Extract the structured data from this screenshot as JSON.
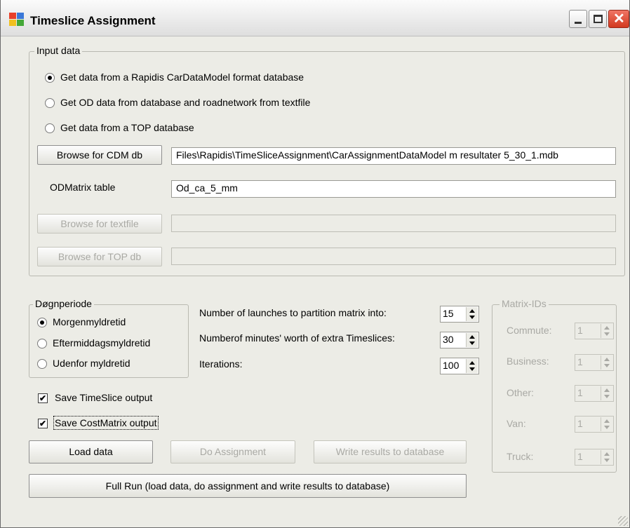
{
  "window": {
    "title": "Timeslice Assignment",
    "icon": "app-windows-icon",
    "controls": {
      "minimize": "minimize-icon",
      "maximize": "maximize-icon",
      "close": "close-icon"
    }
  },
  "input_data": {
    "group_label": "Input data",
    "radios": [
      {
        "label": "Get data from a Rapidis CarDataModel format database",
        "selected": true
      },
      {
        "label": "Get OD data from database and roadnetwork from textfile",
        "selected": false
      },
      {
        "label": "Get data from a TOP database",
        "selected": false
      }
    ],
    "browse_cdm_label": "Browse for CDM db",
    "cdm_path": "Files\\Rapidis\\TimeSliceAssignment\\CarAssignmentDataModel m resultater 5_30_1.mdb",
    "odmatrix_label": "ODMatrix table",
    "odmatrix_value": "Od_ca_5_mm",
    "browse_textfile_label": "Browse for textfile",
    "textfile_value": "",
    "browse_top_label": "Browse for TOP db",
    "top_value": ""
  },
  "dognperiode": {
    "group_label": "Døgnperiode",
    "radios": [
      {
        "label": "Morgenmyldretid",
        "selected": true
      },
      {
        "label": "Eftermiddagsmyldretid",
        "selected": false
      },
      {
        "label": "Udenfor myldretid",
        "selected": false
      }
    ]
  },
  "parameters": {
    "launches_label": "Number of launches to partition matrix into:",
    "launches_value": "15",
    "minutes_label": "Numberof minutes' worth of extra Timeslices:",
    "minutes_value": "30",
    "iterations_label": "Iterations:",
    "iterations_value": "100"
  },
  "matrix_ids": {
    "group_label": "Matrix-IDs",
    "items": [
      {
        "label": "Commute:",
        "value": "1"
      },
      {
        "label": "Business:",
        "value": "1"
      },
      {
        "label": "Other:",
        "value": "1"
      },
      {
        "label": "Van:",
        "value": "1"
      },
      {
        "label": "Truck:",
        "value": "1"
      }
    ]
  },
  "checkboxes": {
    "save_timeslice": {
      "label": "Save TimeSlice output",
      "checked": true
    },
    "save_costmatrix": {
      "label": "Save CostMatrix output",
      "checked": true
    }
  },
  "actions": {
    "load_data": "Load data",
    "do_assignment": "Do Assignment",
    "write_results": "Write results to database",
    "full_run": "Full Run (load data, do assignment and write results to database)"
  },
  "check_mark": "✔",
  "colors": {
    "window_bg": "#ecece6",
    "disabled_text": "#a9a9a4",
    "close_button": "#d2391f"
  }
}
